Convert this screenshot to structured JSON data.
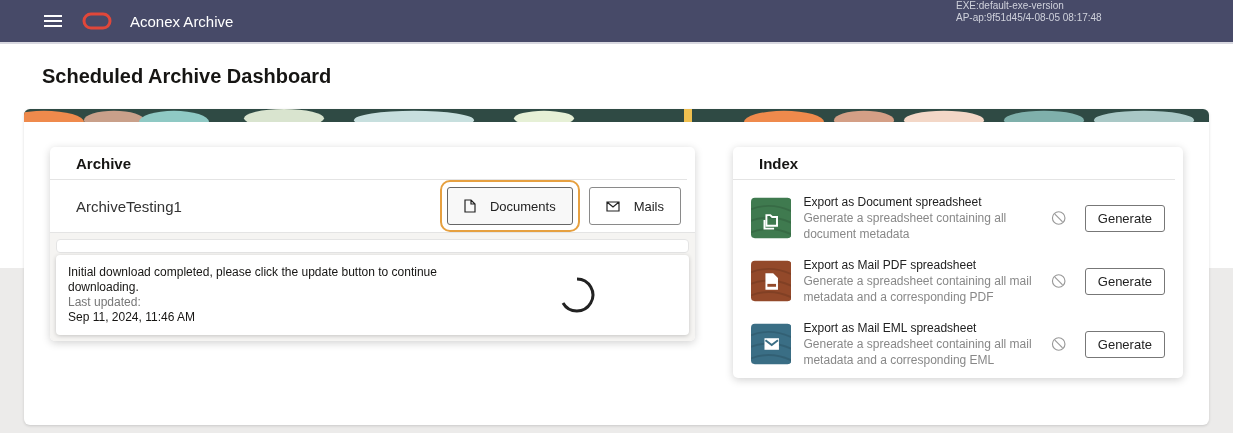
{
  "header": {
    "title": "Aconex Archive",
    "version_lines": [
      "EXE:default-exe-version",
      "AP-ap:9f51d45/4-08-05 08:17:48"
    ]
  },
  "page_title": "Scheduled Archive Dashboard",
  "archive": {
    "title": "Archive",
    "name": "ArchiveTesting1",
    "buttons": [
      {
        "label": "Documents",
        "kind": "document",
        "focused": true
      },
      {
        "label": "Mails",
        "kind": "mail",
        "focused": false
      }
    ],
    "status": {
      "message": "Initial download completed, please click the update button to continue downloading.",
      "updated_label": "Last updated:",
      "updated_value": "Sep 11, 2024, 11:46 AM"
    }
  },
  "index": {
    "title": "Index",
    "items": [
      {
        "kind": "document",
        "color": "#3f7a4f",
        "title": "Export as Document spreadsheet",
        "description": "Generate a spreadsheet containing all document metadata",
        "button": "Generate"
      },
      {
        "kind": "pdf",
        "color": "#93492a",
        "title": "Export as Mail PDF spreadsheet",
        "description": "Generate a spreadsheet containing all mail metadata and a corresponding PDF",
        "button": "Generate"
      },
      {
        "kind": "mail",
        "color": "#3a6e85",
        "title": "Export as Mail EML spreadsheet",
        "description": "Generate a spreadsheet containing all mail metadata and a corresponding EML",
        "button": "Generate"
      }
    ]
  }
}
